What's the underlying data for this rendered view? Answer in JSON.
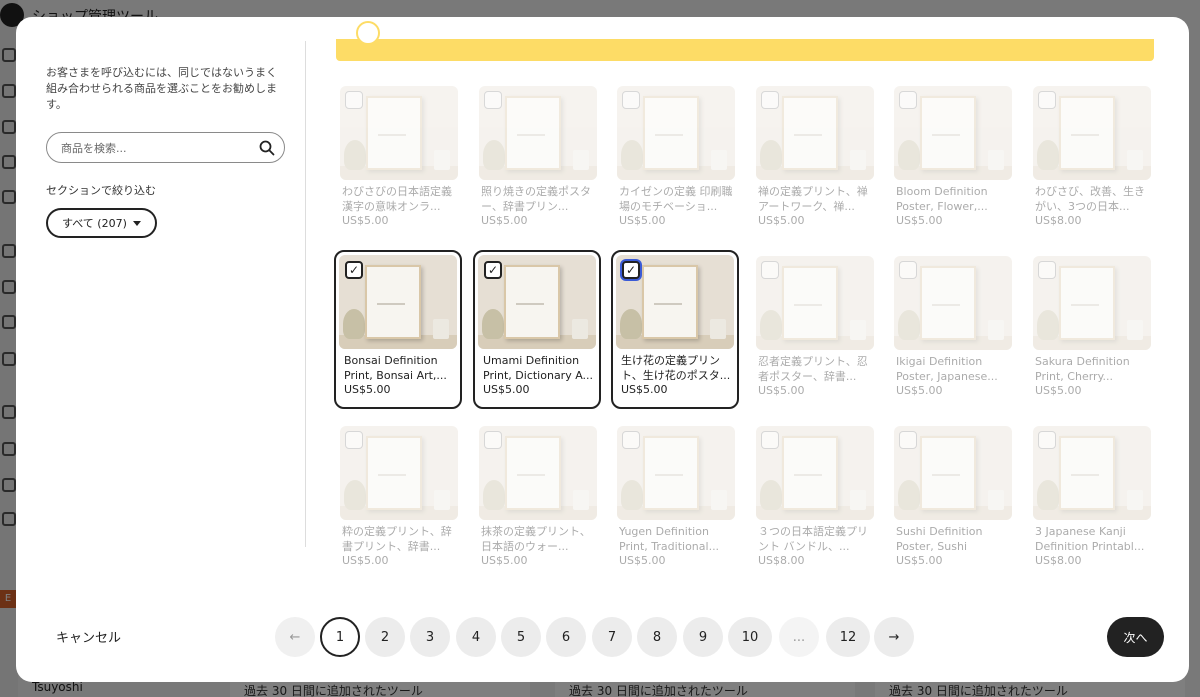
{
  "background": {
    "app_title": "ショップ管理ツール",
    "user_name": "Tsuyoshi",
    "badge": "E",
    "bottom_text": "過去 30 日間に追加されたツール"
  },
  "modal": {
    "intro_text": "お客さまを呼び込むには、同じではないうまく組み合わせられる商品を選ぶことをお勧めします。",
    "search": {
      "placeholder": "商品を検索..."
    },
    "filter_label": "セクションで絞り込む",
    "filter_value": "すべて (207)",
    "products": [
      {
        "title": "わびさびの日本語定義漢字の意味オンラ...",
        "price": "US$5.00",
        "selected": false
      },
      {
        "title": "照り焼きの定義ポスター、辞書プリン...",
        "price": "US$5.00",
        "selected": false
      },
      {
        "title": "カイゼンの定義 印刷職場のモチベーショ...",
        "price": "US$5.00",
        "selected": false
      },
      {
        "title": "禅の定義プリント、禅アートワーク、禅...",
        "price": "US$5.00",
        "selected": false
      },
      {
        "title": "Bloom Definition Poster, Flower,...",
        "price": "US$5.00",
        "selected": false
      },
      {
        "title": "わびさび、改善、生きがい、3つの日本...",
        "price": "US$8.00",
        "selected": false
      },
      {
        "title": "Bonsai Definition Print, Bonsai Art,...",
        "price": "US$5.00",
        "selected": true
      },
      {
        "title": "Umami Definition Print, Dictionary A...",
        "price": "US$5.00",
        "selected": true
      },
      {
        "title": "生け花の定義プリント、生け花のポスタ...",
        "price": "US$5.00",
        "selected": true
      },
      {
        "title": "忍者定義プリント、忍者ポスター、辞書...",
        "price": "US$5.00",
        "selected": false
      },
      {
        "title": "Ikigai Definition Poster, Japanese...",
        "price": "US$5.00",
        "selected": false
      },
      {
        "title": "Sakura Definition Print, Cherry...",
        "price": "US$5.00",
        "selected": false
      },
      {
        "title": "粋の定義プリント、辞書プリント、辞書...",
        "price": "US$5.00",
        "selected": false
      },
      {
        "title": "抹茶の定義プリント、日本語のウォー...",
        "price": "US$5.00",
        "selected": false
      },
      {
        "title": "Yugen Definition Print, Traditional...",
        "price": "US$5.00",
        "selected": false
      },
      {
        "title": "３つの日本語定義プリント バンドル、...",
        "price": "US$8.00",
        "selected": false
      },
      {
        "title": "Sushi Definition Poster, Sushi Poster,...",
        "price": "US$5.00",
        "selected": false
      },
      {
        "title": "3 Japanese Kanji Definition Printabl...",
        "price": "US$8.00",
        "selected": false
      }
    ],
    "pagination": {
      "prev": "←",
      "pages": [
        "1",
        "2",
        "3",
        "4",
        "5",
        "6",
        "7",
        "8",
        "9",
        "10",
        "...",
        "12"
      ],
      "current": "1",
      "next": "→"
    },
    "cancel_label": "キャンセル",
    "next_label": "次へ"
  }
}
